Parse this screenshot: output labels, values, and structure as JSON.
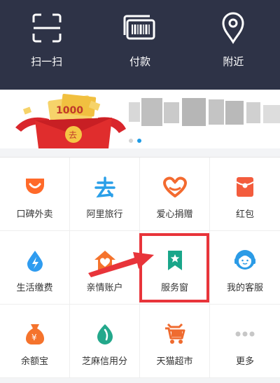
{
  "top_actions": [
    {
      "label": "扫一扫",
      "icon": "scan-icon"
    },
    {
      "label": "付款",
      "icon": "barcode-pay-icon"
    },
    {
      "label": "附近",
      "icon": "location-pin-icon"
    }
  ],
  "banner": {
    "promo_text": "1000",
    "envelope_char": "去",
    "active_slide": 1,
    "slide_count": 2
  },
  "grid": [
    {
      "label": "口碑外卖",
      "icon": "koubei-takeout-icon",
      "color": "#ff6a2a"
    },
    {
      "label": "阿里旅行",
      "icon": "ali-travel-icon",
      "color": "#2a9fe8"
    },
    {
      "label": "爱心捐赠",
      "icon": "heart-donate-icon",
      "color": "#f36a2f"
    },
    {
      "label": "红包",
      "icon": "red-envelope-icon",
      "color": "#f35c3d"
    },
    {
      "label": "生活缴费",
      "icon": "utility-bill-icon",
      "color": "#2f9cf0"
    },
    {
      "label": "亲情账户",
      "icon": "family-account-icon",
      "color": "#f5732c"
    },
    {
      "label": "服务窗",
      "icon": "service-window-icon",
      "color": "#1aa68a"
    },
    {
      "label": "我的客服",
      "icon": "customer-service-icon",
      "color": "#2b9be6"
    },
    {
      "label": "余额宝",
      "icon": "yuebao-icon",
      "color": "#f5732c"
    },
    {
      "label": "芝麻信用分",
      "icon": "sesame-credit-icon",
      "color": "#23a88b"
    },
    {
      "label": "天猫超市",
      "icon": "tmall-market-icon",
      "color": "#ef6b2f"
    },
    {
      "label": "更多",
      "icon": "more-icon",
      "color": "#c7c7c7"
    }
  ],
  "colors": {
    "topbar_bg": "#2e3347",
    "annotation_red": "#e8343a",
    "slide_dot_active": "#1e9be6"
  }
}
